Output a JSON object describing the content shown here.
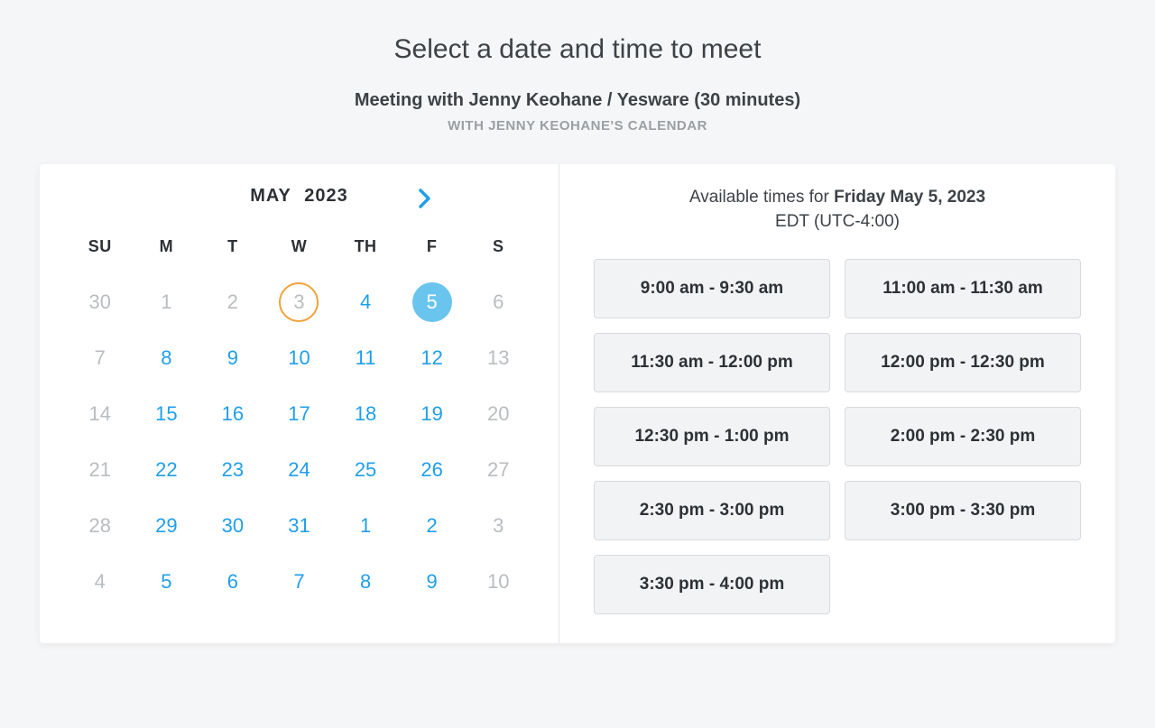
{
  "header": {
    "title": "Select a date and time to meet",
    "subtitle": "Meeting with Jenny Keohane / Yesware (30 minutes)",
    "calname": "WITH JENNY KEOHANE'S CALENDAR"
  },
  "calendar": {
    "month_label": "MAY",
    "year_label": "2023",
    "weekdays": [
      "SU",
      "M",
      "T",
      "W",
      "TH",
      "F",
      "S"
    ],
    "weeks": [
      [
        {
          "n": "30",
          "state": "disabled"
        },
        {
          "n": "1",
          "state": "disabled"
        },
        {
          "n": "2",
          "state": "disabled"
        },
        {
          "n": "3",
          "state": "today"
        },
        {
          "n": "4",
          "state": "available"
        },
        {
          "n": "5",
          "state": "selected"
        },
        {
          "n": "6",
          "state": "disabled"
        }
      ],
      [
        {
          "n": "7",
          "state": "disabled"
        },
        {
          "n": "8",
          "state": "available"
        },
        {
          "n": "9",
          "state": "available"
        },
        {
          "n": "10",
          "state": "available"
        },
        {
          "n": "11",
          "state": "available"
        },
        {
          "n": "12",
          "state": "available"
        },
        {
          "n": "13",
          "state": "disabled"
        }
      ],
      [
        {
          "n": "14",
          "state": "disabled"
        },
        {
          "n": "15",
          "state": "available"
        },
        {
          "n": "16",
          "state": "available"
        },
        {
          "n": "17",
          "state": "available"
        },
        {
          "n": "18",
          "state": "available"
        },
        {
          "n": "19",
          "state": "available"
        },
        {
          "n": "20",
          "state": "disabled"
        }
      ],
      [
        {
          "n": "21",
          "state": "disabled"
        },
        {
          "n": "22",
          "state": "available"
        },
        {
          "n": "23",
          "state": "available"
        },
        {
          "n": "24",
          "state": "available"
        },
        {
          "n": "25",
          "state": "available"
        },
        {
          "n": "26",
          "state": "available"
        },
        {
          "n": "27",
          "state": "disabled"
        }
      ],
      [
        {
          "n": "28",
          "state": "disabled"
        },
        {
          "n": "29",
          "state": "available"
        },
        {
          "n": "30",
          "state": "available"
        },
        {
          "n": "31",
          "state": "available"
        },
        {
          "n": "1",
          "state": "available"
        },
        {
          "n": "2",
          "state": "available"
        },
        {
          "n": "3",
          "state": "disabled"
        }
      ],
      [
        {
          "n": "4",
          "state": "disabled"
        },
        {
          "n": "5",
          "state": "available"
        },
        {
          "n": "6",
          "state": "available"
        },
        {
          "n": "7",
          "state": "available"
        },
        {
          "n": "8",
          "state": "available"
        },
        {
          "n": "9",
          "state": "available"
        },
        {
          "n": "10",
          "state": "disabled"
        }
      ]
    ]
  },
  "times": {
    "prefix": "Available times for ",
    "date_bold": "Friday May 5, 2023",
    "tz": "EDT (UTC-4:00)",
    "slots": [
      "9:00 am - 9:30 am",
      "11:00 am - 11:30 am",
      "11:30 am - 12:00 pm",
      "12:00 pm - 12:30 pm",
      "12:30 pm - 1:00 pm",
      "2:00 pm - 2:30 pm",
      "2:30 pm - 3:00 pm",
      "3:00 pm - 3:30 pm",
      "3:30 pm - 4:00 pm"
    ]
  }
}
